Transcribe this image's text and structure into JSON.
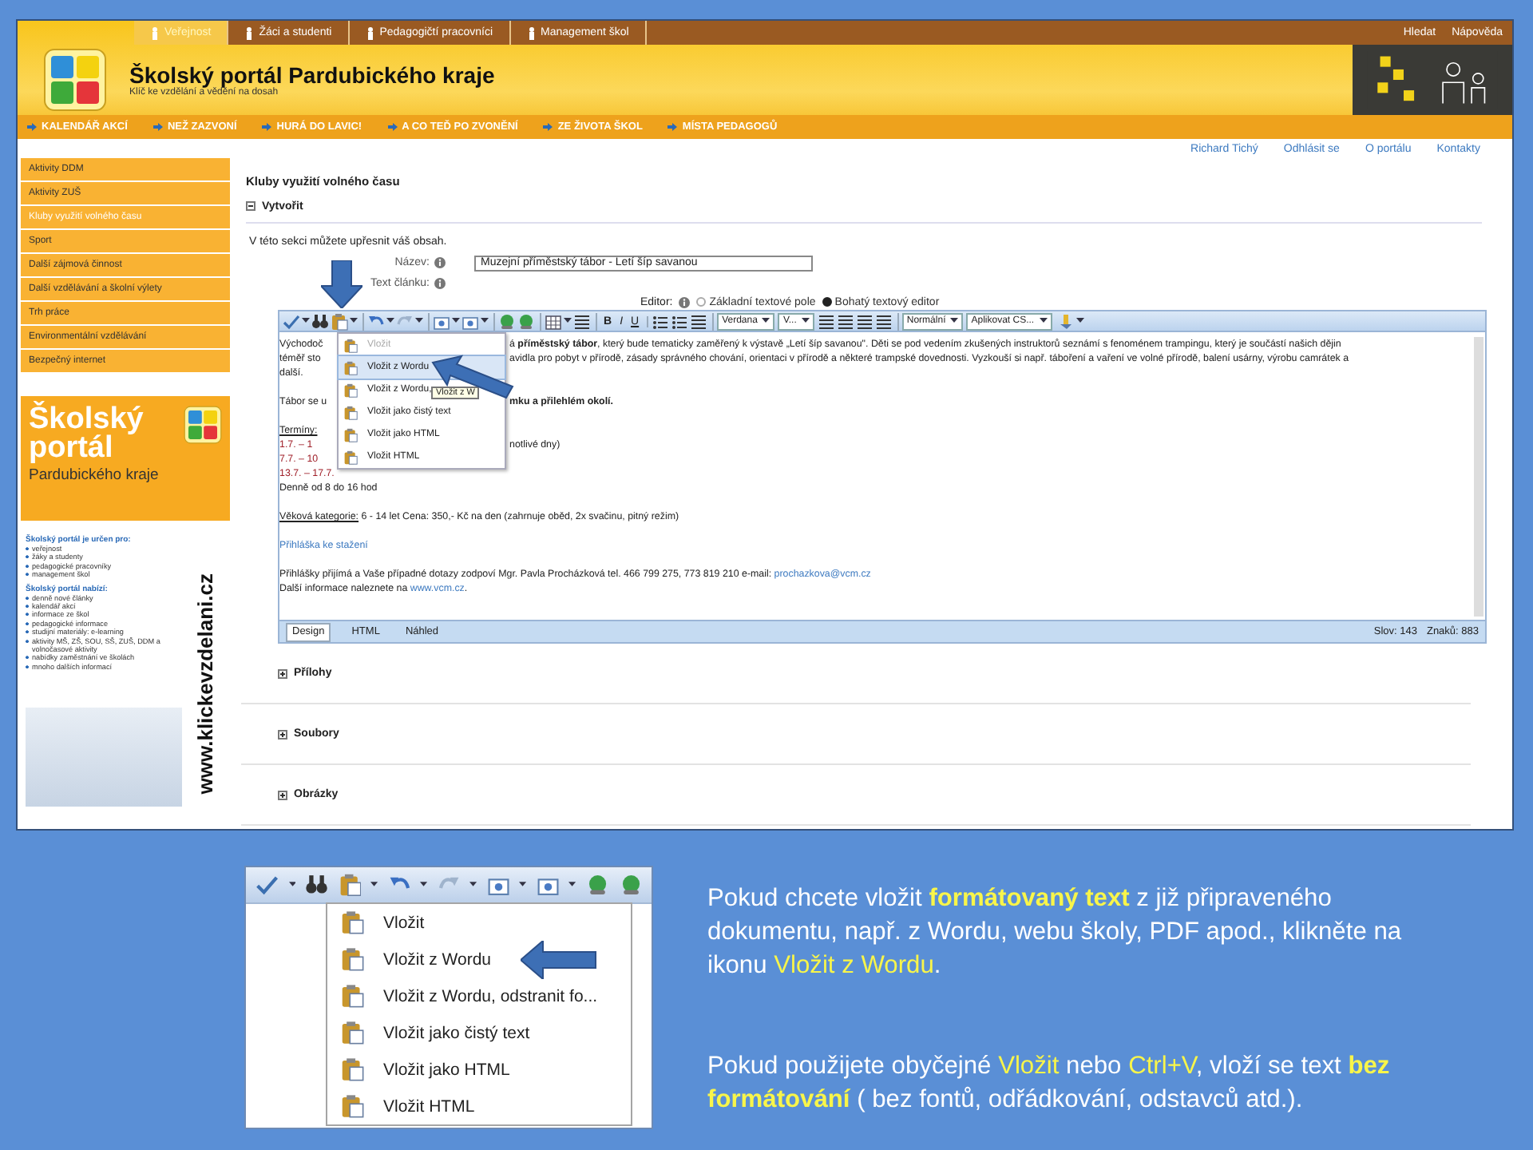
{
  "header": {
    "top_nav": [
      {
        "label": "Veřejnost",
        "selected": true
      },
      {
        "label": "Žáci a studenti",
        "selected": false
      },
      {
        "label": "Pedagogičtí pracovníci",
        "selected": false
      },
      {
        "label": "Management škol",
        "selected": false
      }
    ],
    "search": "Hledat",
    "help": "Nápověda",
    "title": "Školský portál Pardubického kraje",
    "subtitle": "Klíč ke vzdělání a vědění na dosah",
    "main_nav": [
      "KALENDÁŘ AKCÍ",
      "NEŽ ZAZVONÍ",
      "HURÁ DO LAVIC!",
      "A CO TEĎ PO ZVONĚNÍ",
      "ZE ŽIVOTA ŠKOL",
      "MÍSTA PEDAGOGŮ"
    ]
  },
  "user_links": [
    "Richard Tichý",
    "Odhlásit se",
    "O portálu",
    "Kontakty"
  ],
  "sidebar": {
    "items": [
      {
        "label": "Aktivity DDM",
        "selected": false
      },
      {
        "label": "Aktivity ZUŠ",
        "selected": false
      },
      {
        "label": "Kluby využití volného času",
        "selected": true
      },
      {
        "label": "Sport",
        "selected": false
      },
      {
        "label": "Další zájmová činnost",
        "selected": false
      },
      {
        "label": "Další vzdělávání a školní výlety",
        "selected": false
      },
      {
        "label": "Trh práce",
        "selected": false
      },
      {
        "label": "Environmentální vzdělávání",
        "selected": false
      },
      {
        "label": "Bezpečný internet",
        "selected": false
      }
    ],
    "banner": {
      "title_lines": [
        "Školský",
        "portál"
      ],
      "subtitle": "Pardubického kraje",
      "lists": [
        {
          "heading": "Školský portál je určen pro:",
          "items": [
            "veřejnost",
            "žáky a studenty",
            "pedagogické pracovníky",
            "management škol"
          ]
        },
        {
          "heading": "Školský portál nabízí:",
          "items": [
            "denně nové články",
            "kalendář akcí",
            "informace ze škol",
            "pedagogické informace",
            "studijní materiály: e-learning",
            "aktivity MŠ, ZŠ, SOU, SŠ, ZUŠ, DDM a volnočasové aktivity",
            "nabídky zaměstnání ve školách",
            "mnoho dalších informací"
          ]
        }
      ],
      "url": "www.klickevzdelani.cz"
    }
  },
  "page": {
    "title": "Kluby využití volného času",
    "section": {
      "title": "Vytvořit",
      "expanded": true
    },
    "intro": "V této sekci můžete upřesnit váš obsah.",
    "fields": [
      {
        "label": "Název:",
        "value": "Muzejní příměstský tábor - Letí šíp savanou"
      },
      {
        "label": "Text článku:"
      }
    ],
    "editor_label": "Editor:",
    "editor_modes": [
      {
        "label": "Základní textové pole",
        "selected": false
      },
      {
        "label": "Bohatý textový editor",
        "selected": true
      }
    ]
  },
  "editor": {
    "toolbar": {
      "glyphs": [
        "B",
        "I",
        "U"
      ],
      "font": "Verdana",
      "size": "V...",
      "format": "Normální",
      "css": "Aplikovat CS..."
    },
    "paste_menu": {
      "items": [
        {
          "label": "Vložit",
          "disabled": true,
          "selected": false
        },
        {
          "label": "Vložit z Wordu",
          "disabled": false,
          "selected": true
        },
        {
          "label": "Vložit z Wordu,",
          "disabled": false,
          "selected": false
        },
        {
          "label": "Vložit jako čistý text",
          "disabled": false,
          "selected": false
        },
        {
          "label": "Vložit jako HTML",
          "disabled": false,
          "selected": false
        },
        {
          "label": "Vložit HTML",
          "disabled": false,
          "selected": false
        }
      ],
      "tooltip": "Vložit z W"
    },
    "lines": [
      {
        "kind": "split",
        "left": [
          {
            "text": "Východoč",
            "kind": "plain"
          }
        ],
        "right": [
          {
            "text": "á ",
            "kind": "plain"
          },
          {
            "text": "příměstský tábor",
            "kind": "bold"
          },
          {
            "text": ", který bude tematicky zaměřený k výstavě „Letí šíp savanou\". Děti se pod vedením zkušených instruktorů seznámí s fenoménem trampingu, který je součástí našich dějin",
            "kind": "plain"
          }
        ]
      },
      {
        "kind": "split",
        "left": [
          {
            "text": "téměř sto",
            "kind": "plain"
          }
        ],
        "right": [
          {
            "text": "avidla pro pobyt v přírodě, zásady správného chování, orientaci v přírodě a některé trampské dovednosti. Vyzkouší si např. táboření a vaření ve volné přírodě, balení usárny, výrobu camrátek a",
            "kind": "plain"
          }
        ]
      },
      {
        "kind": "full",
        "parts": [
          {
            "text": "další.",
            "kind": "plain"
          }
        ]
      },
      {
        "kind": "blank"
      },
      {
        "kind": "split",
        "left": [
          {
            "text": "Tábor se u",
            "kind": "plain"
          }
        ],
        "right": [
          {
            "text": "mku a přilehlém okolí.",
            "kind": "bold"
          }
        ]
      },
      {
        "kind": "blank"
      },
      {
        "kind": "full",
        "parts": [
          {
            "text": "Termíny:",
            "kind": "underline"
          }
        ]
      },
      {
        "kind": "split",
        "left": [
          {
            "text": "1.7. – 1",
            "kind": "date"
          }
        ],
        "right": [
          {
            "text": "notlivé dny)",
            "kind": "plain"
          }
        ]
      },
      {
        "kind": "split",
        "left": [
          {
            "text": "7.7. – 10",
            "kind": "date"
          }
        ]
      },
      {
        "kind": "full",
        "parts": [
          {
            "text": "13.7. – 17.7.",
            "kind": "date"
          }
        ]
      },
      {
        "kind": "full",
        "parts": [
          {
            "text": "Denně od 8 do 16 hod",
            "kind": "plain"
          }
        ]
      },
      {
        "kind": "blank"
      },
      {
        "kind": "full",
        "parts": [
          {
            "text": "Věková kategorie:",
            "kind": "underline"
          },
          {
            "text": " 6 - 14 let Cena: 350,- Kč na den (zahrnuje oběd, 2x svačinu, pitný režim)",
            "kind": "plain"
          }
        ]
      },
      {
        "kind": "blank"
      },
      {
        "kind": "full",
        "parts": [
          {
            "text": "Přihláška ke stažení",
            "kind": "link"
          }
        ]
      },
      {
        "kind": "blank"
      },
      {
        "kind": "full",
        "parts": [
          {
            "text": "Přihlášky přijímá a Vaše případné dotazy zodpoví Mgr. Pavla Procházková tel. 466 799 275, 773 819 210 e-mail: ",
            "kind": "plain"
          },
          {
            "text": "prochazkova@vcm.cz",
            "kind": "link"
          }
        ]
      },
      {
        "kind": "full",
        "parts": [
          {
            "text": "Další informace naleznete na ",
            "kind": "plain"
          },
          {
            "text": "www.vcm.cz",
            "kind": "link"
          },
          {
            "text": ".",
            "kind": "plain"
          }
        ]
      }
    ],
    "modes": [
      {
        "label": "Design",
        "selected": true
      },
      {
        "label": "HTML",
        "selected": false
      },
      {
        "label": "Náhled",
        "selected": false
      }
    ],
    "words": "Slov: 143",
    "chars": "Znaků: 883"
  },
  "collapsed_sections": [
    {
      "title": "Přílohy",
      "expanded": false
    },
    {
      "title": "Soubory",
      "expanded": false
    },
    {
      "title": "Obrázky",
      "expanded": false
    }
  ],
  "zoomed_menu": [
    "Vložit",
    "Vložit z Wordu",
    "Vložit z Wordu, odstranit fo...",
    "Vložit jako čistý text",
    "Vložit jako HTML",
    "Vložit HTML"
  ],
  "instructions": [
    [
      {
        "text": "Pokud chcete vložit ",
        "kind": "plain"
      },
      {
        "text": "formátovaný text",
        "kind": "highlight-bold"
      },
      {
        "text": " z již připraveného dokumentu, např. z Wordu, webu školy, PDF apod., klikněte na ikonu ",
        "kind": "plain"
      },
      {
        "text": "Vložit z Wordu",
        "kind": "highlight"
      },
      {
        "text": ".",
        "kind": "plain"
      }
    ],
    [
      {
        "text": "Pokud použijete obyčejné ",
        "kind": "plain"
      },
      {
        "text": "Vložit",
        "kind": "highlight"
      },
      {
        "text": " nebo ",
        "kind": "plain"
      },
      {
        "text": "Ctrl+V",
        "kind": "highlight"
      },
      {
        "text": ", vloží se text ",
        "kind": "plain"
      },
      {
        "text": "bez formátování",
        "kind": "highlight-bold"
      },
      {
        "text": " ( bez fontů, odřádkování, odstavců atd.).",
        "kind": "plain"
      }
    ]
  ]
}
